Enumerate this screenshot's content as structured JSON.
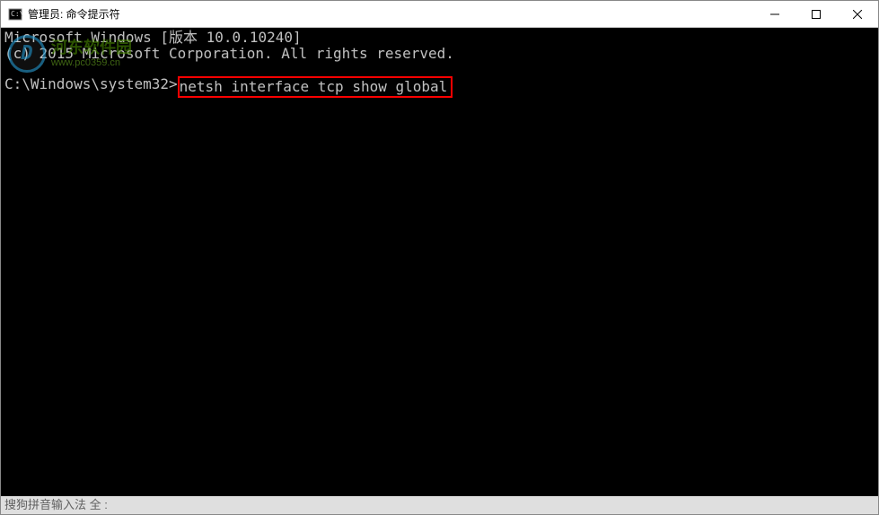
{
  "titlebar": {
    "title": "管理员: 命令提示符"
  },
  "terminal": {
    "line1": "Microsoft Windows [版本 10.0.10240]",
    "line2": "(c) 2015 Microsoft Corporation. All rights reserved.",
    "prompt": "C:\\Windows\\system32>",
    "command": "netsh interface tcp show global"
  },
  "watermark": {
    "logo_letter": "D",
    "site_name": "河东软件园",
    "site_url": "www.pc0359.cn"
  },
  "ime": {
    "status": "搜狗拼音输入法 全 :"
  }
}
